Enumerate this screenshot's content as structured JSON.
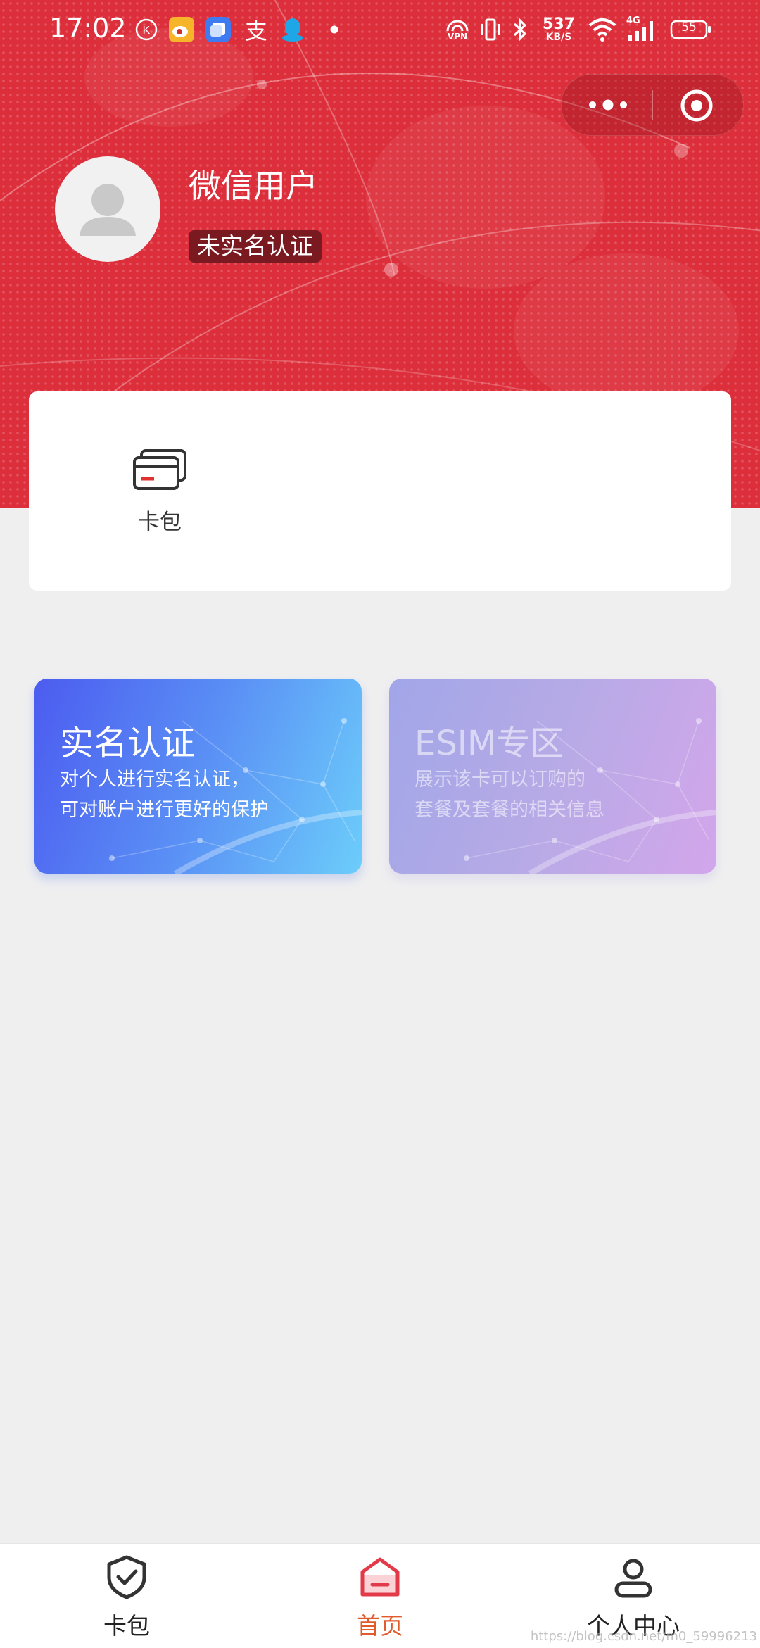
{
  "status_bar": {
    "time": "17:02",
    "net_speed_value": "537",
    "net_speed_unit": "KB/S",
    "vpn_label": "VPN",
    "network_type": "4G",
    "battery": "55"
  },
  "profile": {
    "username": "微信用户",
    "verification_status": "未实名认证"
  },
  "quick_actions": {
    "wallet_label": "卡包"
  },
  "promos": [
    {
      "title": "实名认证",
      "desc_line1": "对个人进行实名认证，",
      "desc_line2": "可对账户进行更好的保护"
    },
    {
      "title": "ESIM专区",
      "desc_line1": "展示该卡可以订购的",
      "desc_line2": "套餐及套餐的相关信息"
    }
  ],
  "tabbar": {
    "items": [
      {
        "label": "卡包",
        "icon": "shield-check-icon"
      },
      {
        "label": "首页",
        "icon": "home-icon",
        "active": true
      },
      {
        "label": "个人中心",
        "icon": "person-icon"
      }
    ]
  },
  "watermark": "https://blog.csdn.net/m0_59996213",
  "colors": {
    "header_red": "#dc2f3b",
    "badge_bg": "#7a1a20",
    "active_tab": "#e05a2b",
    "promo1_start": "#4c5cf0",
    "promo1_end": "#6ccdfa",
    "promo2_start": "#a1a6e8",
    "promo2_end": "#d3a6ea"
  }
}
